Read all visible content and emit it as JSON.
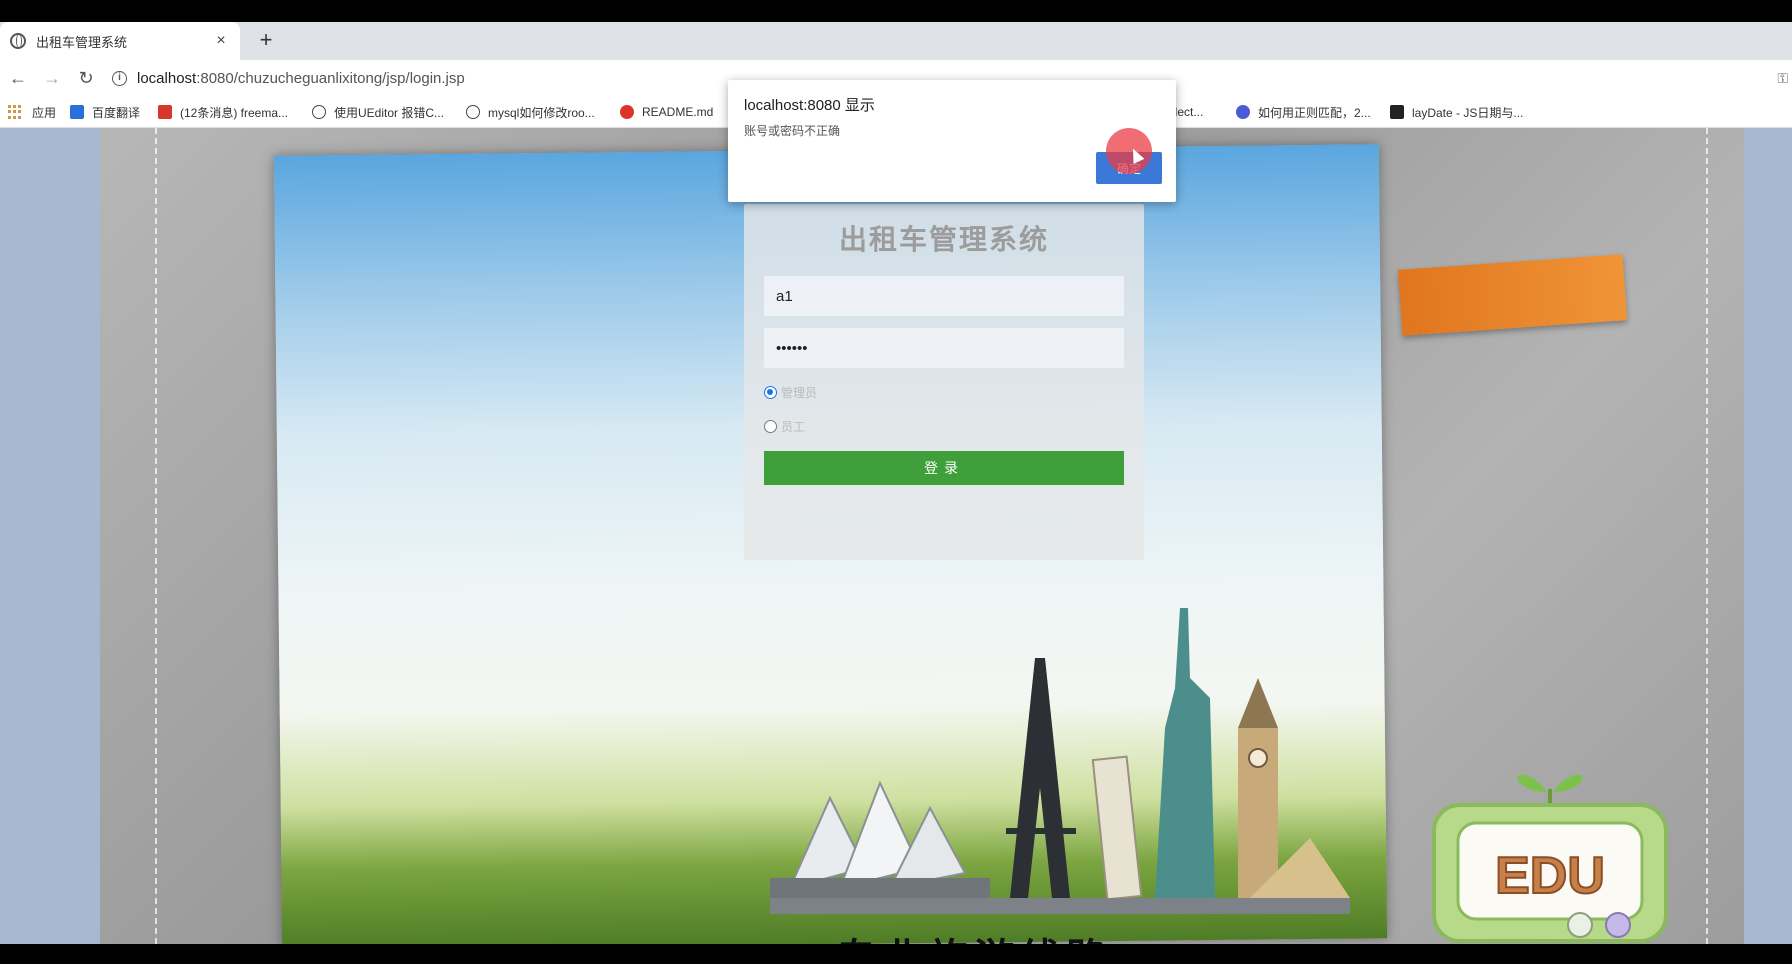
{
  "browser": {
    "tab_title": "出租车管理系统",
    "tab_close": "×",
    "new_tab": "+",
    "url_host": "localhost",
    "url_rest": ":8080/chuzucheguanlixitong/jsp/login.jsp",
    "bookmarks": [
      {
        "label": "应用",
        "color": "#c94"
      },
      {
        "label": "百度翻译",
        "color": "#2b6fd8"
      },
      {
        "label": "(12条消息) freema...",
        "color": "#d9362b"
      },
      {
        "label": "使用UEditor 报错C...",
        "color": "#444"
      },
      {
        "label": "mysql如何修改roo...",
        "color": "#444"
      },
      {
        "label": "README.md",
        "color": "#d9362b"
      },
      {
        "label": "elect...",
        "color": "#444"
      },
      {
        "label": "如何用正则匹配，2...",
        "color": "#4a5bd6"
      },
      {
        "label": "layDate - JS日期与...",
        "color": "#222"
      }
    ]
  },
  "dialog": {
    "title": "localhost:8080 显示",
    "message": "账号或密码不正确",
    "ok_label": "确定"
  },
  "login": {
    "system_title": "出租车管理系统",
    "username_value": "a1",
    "password_value": "••••••",
    "role_admin": "管理员",
    "role_staff": "员工",
    "submit_label": "登录"
  },
  "page": {
    "bottom_text": "专业旅游线路"
  },
  "colors": {
    "login_button": "#3f9f3a",
    "dialog_button": "#3b78d8",
    "tape": "#e88a2e"
  }
}
